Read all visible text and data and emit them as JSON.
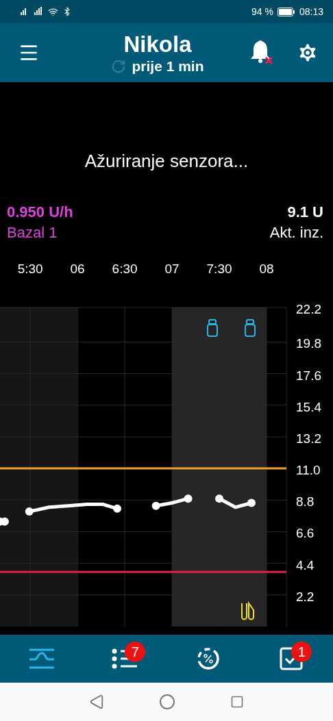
{
  "status_bar": {
    "battery": "94 %",
    "time": "08:13"
  },
  "header": {
    "title": "Nikola",
    "subtitle": "prije 1 min"
  },
  "message": "Ažuriranje senzora...",
  "basal": {
    "rate": "0.950 U/h",
    "name": "Bazal 1"
  },
  "active_insulin": {
    "value": "9.1 U",
    "label": "Akt. inz."
  },
  "chart_data": {
    "type": "line",
    "xlim": [
      5.18,
      8.21
    ],
    "ylim": [
      0,
      22.2
    ],
    "xticks": [
      {
        "value": 5.5,
        "label": "5:30"
      },
      {
        "value": 6,
        "label": "06"
      },
      {
        "value": 6.5,
        "label": "6:30"
      },
      {
        "value": 7,
        "label": "07"
      },
      {
        "value": 7.5,
        "label": "7:30"
      },
      {
        "value": 8,
        "label": "08"
      }
    ],
    "yticks": [
      {
        "value": 2.2,
        "label": "2.2"
      },
      {
        "value": 4.4,
        "label": "4.4"
      },
      {
        "value": 6.6,
        "label": "6.6"
      },
      {
        "value": 8.8,
        "label": "8.8"
      },
      {
        "value": 11,
        "label": "11.0"
      },
      {
        "value": 13.2,
        "label": "13.2"
      },
      {
        "value": 15.4,
        "label": "15.4"
      },
      {
        "value": 17.6,
        "label": "17.6"
      },
      {
        "value": 19.8,
        "label": "19.8"
      },
      {
        "value": 22.2,
        "label": "22.2"
      }
    ],
    "grid": true,
    "x": [
      5.18,
      5.23,
      5.49,
      5.7,
      5.9,
      6.1,
      6.27,
      6.42,
      6.83,
      7.0,
      7.17,
      7.5,
      7.67,
      7.84
    ],
    "series": [
      {
        "color": "#ffffff",
        "values": [
          7.3,
          7.3,
          8.0,
          8.3,
          8.4,
          8.5,
          8.5,
          8.2,
          8.4,
          8.6,
          8.9,
          8.9,
          8.3,
          8.6
        ]
      }
    ],
    "bands": [
      {
        "axis": "x",
        "from": 5.18,
        "to": 6.0,
        "color": "#161616"
      },
      {
        "axis": "x",
        "from": 7.0,
        "to": 8.0,
        "color": "#262626"
      }
    ],
    "ref_lines": [
      {
        "axis": "y",
        "value": 11.0,
        "color": "#f0a030"
      },
      {
        "axis": "y",
        "value": 3.8,
        "color": "#e0204a"
      }
    ]
  },
  "chart_events": [
    {
      "kind": "insulin"
    },
    {
      "kind": "insulin"
    },
    {
      "kind": "meal"
    }
  ],
  "nav": [
    {
      "kind": "graph",
      "selected": true
    },
    {
      "kind": "list",
      "selected": false,
      "badge": "7"
    },
    {
      "kind": "percent",
      "selected": false
    },
    {
      "kind": "tasks",
      "selected": false,
      "badge": "1"
    }
  ]
}
